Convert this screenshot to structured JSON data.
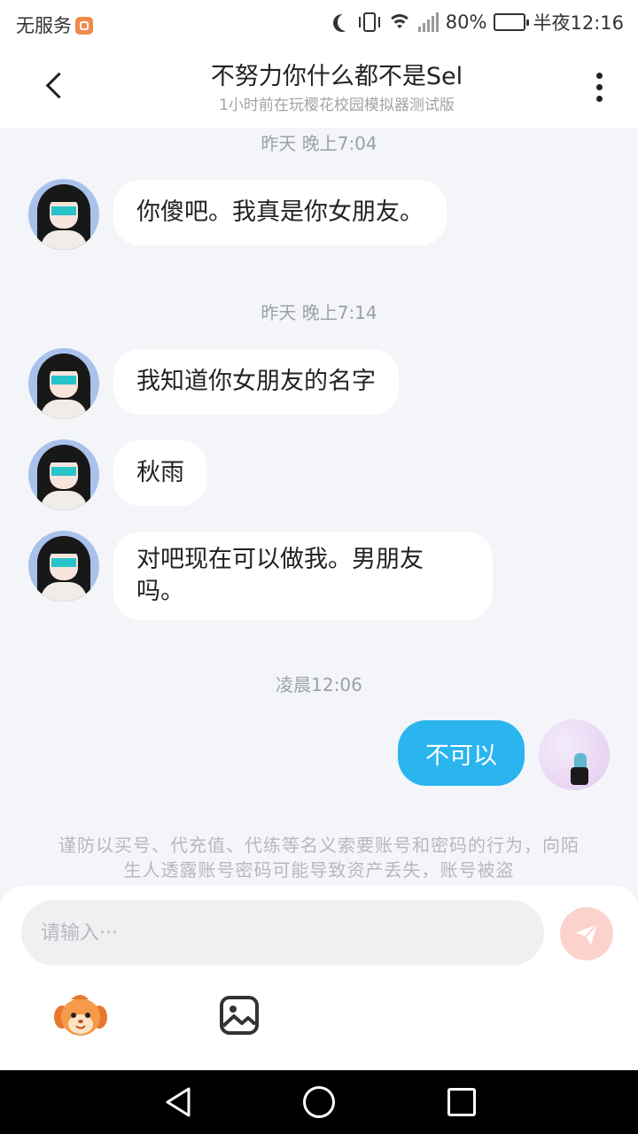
{
  "status_bar": {
    "carrier": "无服务",
    "battery_percent": "80%",
    "battery_level": 0.8,
    "time": "半夜12:16"
  },
  "header": {
    "title": "不努力你什么都不是Sel",
    "subtitle": "1小时前在玩樱花校园模拟器测试版"
  },
  "messages": [
    {
      "timestamp": "昨天 晚上7:04",
      "items": [
        {
          "sender": "other",
          "text": "你傻吧。我真是你女朋友。"
        }
      ]
    },
    {
      "timestamp": "昨天 晚上7:14",
      "items": [
        {
          "sender": "other",
          "text": "我知道你女朋友的名字"
        },
        {
          "sender": "other",
          "text": "秋雨"
        },
        {
          "sender": "other",
          "text": "对吧现在可以做我。男朋友吗。"
        }
      ]
    },
    {
      "timestamp": "凌晨12:06",
      "items": [
        {
          "sender": "me",
          "text": "不可以"
        }
      ]
    }
  ],
  "notice": "谨防以买号、代充值、代练等名义索要账号和密码的行为，向陌生人透露账号密码可能导致资产丢失，账号被盗",
  "composer": {
    "placeholder": "请输入···"
  },
  "colors": {
    "my_bubble": "#2bb5ef",
    "send_button": "#fbd2cc",
    "background": "#f3f5f9"
  }
}
